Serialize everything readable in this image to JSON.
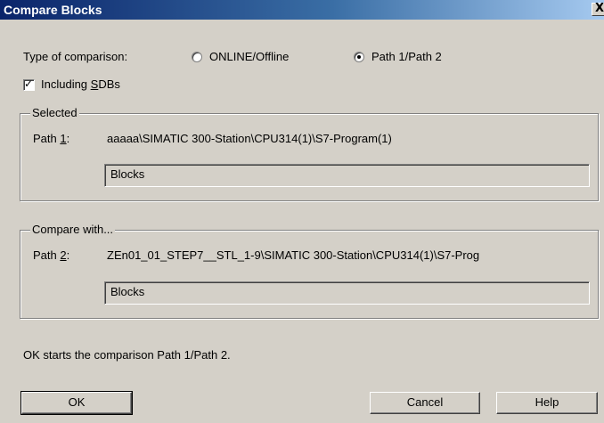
{
  "window": {
    "title": "Compare Blocks",
    "close_glyph": "X"
  },
  "options": {
    "type_label": "Type of comparison:",
    "radio_online_label": "ONLINE/Offline",
    "radio_path_label": "Path 1/Path 2",
    "selected_option": "Path 1/Path 2",
    "include_sdbs_pre": "Including ",
    "include_sdbs_key": "S",
    "include_sdbs_post": "DBs",
    "include_sdbs_checked": true
  },
  "selected_group": {
    "legend": "Selected",
    "path_label_pre": "Path ",
    "path_label_key": "1",
    "path_label_post": ":",
    "path_value": "aaaaa\\SIMATIC 300-Station\\CPU314(1)\\S7-Program(1)",
    "field_value": "Blocks"
  },
  "compare_group": {
    "legend": "Compare with...",
    "path_label_pre": "Path ",
    "path_label_key": "2",
    "path_label_post": ":",
    "path_value": "ZEn01_01_STEP7__STL_1-9\\SIMATIC 300-Station\\CPU314(1)\\S7-Prog",
    "field_value": "Blocks"
  },
  "status_text": "OK starts the comparison Path 1/Path 2.",
  "buttons": {
    "ok": "OK",
    "cancel": "Cancel",
    "help": "Help"
  }
}
